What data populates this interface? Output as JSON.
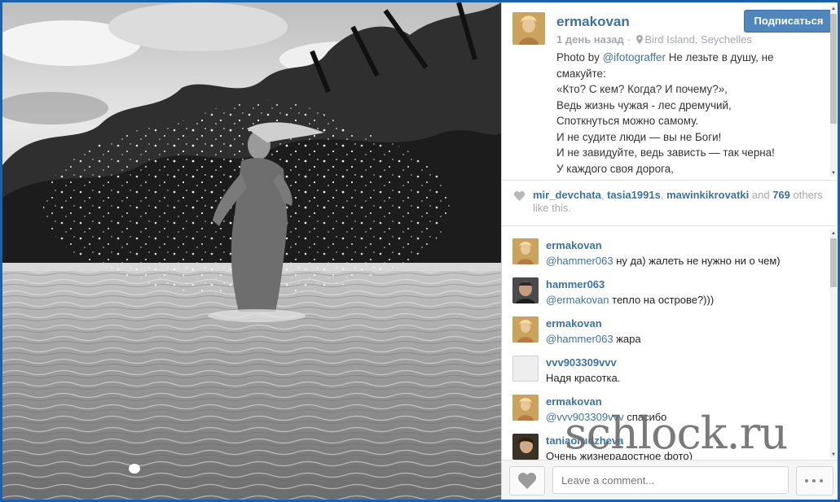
{
  "post": {
    "username": "ermakovan",
    "follow_label": "Подписаться",
    "time": "1 день назад",
    "location": "Bird Island, Seychelles",
    "caption_prefix": "Photo by",
    "caption_mention": "@ifotograffer",
    "caption_lines": [
      "Не лезьте в душу, не смакуйте:",
      "«Кто? С кем? Когда? И почему?»,",
      "Ведь жизнь чужая - лес дремучий,",
      "Споткнуться можно самому.",
      "И не судите люди — вы не Боги!",
      "И не завидуйте, ведь зависть — так черна!",
      "У каждого своя дорога,"
    ]
  },
  "likes": {
    "users": [
      "mir_devchata",
      "tasia1991s",
      "mawinkikrovatki"
    ],
    "and_label": "and",
    "count": "769",
    "suffix": "others like this."
  },
  "comments": [
    {
      "user": "ermakovan",
      "mention": "@hammer063",
      "text": "ну да) жалеть не нужно ни о чем)",
      "avatar": "ermakovan"
    },
    {
      "user": "hammer063",
      "mention": "@ermakovan",
      "text": "тепло на острове?)))",
      "avatar": "hammer063"
    },
    {
      "user": "ermakovan",
      "mention": "@hammer063",
      "text": "жара",
      "avatar": "ermakovan"
    },
    {
      "user": "vvv903309vvv",
      "mention": "",
      "text": "Надя красотка.",
      "avatar": "default"
    },
    {
      "user": "ermakovan",
      "mention": "@vvv903309vvv",
      "text": "спасибо",
      "avatar": "ermakovan"
    },
    {
      "user": "taniaorudzheva",
      "mention": "",
      "text": "Очень жизнерадостное фото)",
      "avatar": "taniaorudzheva"
    }
  ],
  "footer": {
    "comment_placeholder": "Leave a comment..."
  },
  "watermark": "schlock.ru",
  "icons": {
    "location": "map-pin-icon",
    "like": "heart-icon",
    "more": "ellipsis-icon"
  },
  "colors": {
    "link": "#3f729b",
    "follow_button": "#4f87bd",
    "muted": "#a5a7aa",
    "page_border": "#1f5fa8"
  }
}
